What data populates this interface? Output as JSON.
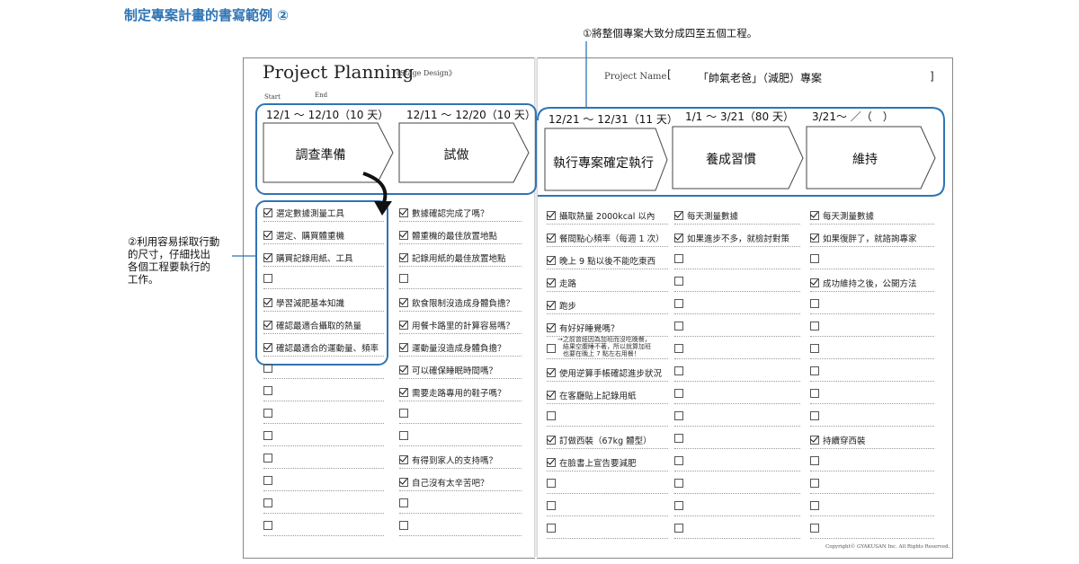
{
  "heading": "制定專案計畫的書寫範例 ②",
  "annotation_top": "①將整個專案大致分成四至五個工程。",
  "annotation_side": [
    "②利用容易採取行動",
    "的尺寸，仔細找出",
    "各個工程要執行的",
    "工作。"
  ],
  "planner": {
    "title": "Project Planning",
    "subtitle": "《Stage Design》",
    "start_label": "Start",
    "end_label": "End",
    "project_name_label": "Project Name",
    "bracket_open": "[",
    "bracket_close": "]",
    "project_name_value": "「帥氣老爸」（減肥）專案",
    "copyright": "Copyright© GYAKUSAN Inc. All Rights Reserved."
  },
  "stages": [
    {
      "dates": "12/1 ～ 12/10（10 天）",
      "name": "調查準備"
    },
    {
      "dates": "12/11 ～ 12/20（10 天）",
      "name": "試做"
    },
    {
      "dates": "12/21 ～ 12/31（11 天）",
      "name": "執行專案確定執行"
    },
    {
      "dates": "1/1 ～ 3/21（80 天）",
      "name": "養成習慣"
    },
    {
      "dates": "3/21～ ／（　）",
      "name": "維持"
    }
  ],
  "tasks": [
    [
      {
        "text": "選定數據測量工具",
        "checked": true
      },
      {
        "text": "選定、購買體重機",
        "checked": true
      },
      {
        "text": "購買記錄用紙、工具",
        "checked": true
      },
      {
        "text": "",
        "checked": false
      },
      {
        "text": "學習減肥基本知識",
        "checked": true
      },
      {
        "text": "確認最適合攝取的熱量",
        "checked": true
      },
      {
        "text": "確認最適合的運動量、頻率",
        "checked": true
      },
      {
        "text": "",
        "checked": false
      },
      {
        "text": "",
        "checked": false
      },
      {
        "text": "",
        "checked": false
      },
      {
        "text": "",
        "checked": false
      },
      {
        "text": "",
        "checked": false
      },
      {
        "text": "",
        "checked": false
      },
      {
        "text": "",
        "checked": false
      },
      {
        "text": "",
        "checked": false
      }
    ],
    [
      {
        "text": "數據確認完成了嗎？",
        "checked": true
      },
      {
        "text": "體重機的最佳放置地點",
        "checked": true
      },
      {
        "text": "記錄用紙的最佳放置地點",
        "checked": true
      },
      {
        "text": "",
        "checked": false
      },
      {
        "text": "飲食限制沒造成身體負擔？",
        "checked": true
      },
      {
        "text": "用餐卡路里的計算容易嗎？",
        "checked": true
      },
      {
        "text": "運動量沒造成身體負擔？",
        "checked": true
      },
      {
        "text": "可以確保睡眠時間嗎？",
        "checked": true
      },
      {
        "text": "需要走路專用的鞋子嗎？",
        "checked": true
      },
      {
        "text": "",
        "checked": false
      },
      {
        "text": "",
        "checked": false
      },
      {
        "text": "有得到家人的支持嗎？",
        "checked": true
      },
      {
        "text": "自己沒有太辛苦吧？",
        "checked": true
      },
      {
        "text": "",
        "checked": false
      },
      {
        "text": "",
        "checked": false
      }
    ],
    [
      {
        "text": "攝取熱量 2000kcal 以內",
        "checked": true
      },
      {
        "text": "餐間點心頻率（每週 1 次）",
        "checked": true
      },
      {
        "text": "晚上 9 點以後不能吃東西",
        "checked": true
      },
      {
        "text": "走路",
        "checked": true
      },
      {
        "text": "跑步",
        "checked": true
      },
      {
        "text": "有好好睡覺嗎？",
        "checked": true
      },
      {
        "text": "",
        "checked": false
      },
      {
        "text": "使用逆算手帳確認進步狀況",
        "checked": true
      },
      {
        "text": "在客廳貼上記錄用紙",
        "checked": true
      },
      {
        "text": "",
        "checked": false
      },
      {
        "text": "訂做西裝（67kg 體型）",
        "checked": true
      },
      {
        "text": "在臉書上宣告要減肥",
        "checked": true
      },
      {
        "text": "",
        "checked": false
      },
      {
        "text": "",
        "checked": false
      },
      {
        "text": "",
        "checked": false
      }
    ],
    [
      {
        "text": "每天測量數據",
        "checked": true
      },
      {
        "text": "如果進步不多，就檢討對策",
        "checked": true
      },
      {
        "text": "",
        "checked": false
      },
      {
        "text": "",
        "checked": false
      },
      {
        "text": "",
        "checked": false
      },
      {
        "text": "",
        "checked": false
      },
      {
        "text": "",
        "checked": false
      },
      {
        "text": "",
        "checked": false
      },
      {
        "text": "",
        "checked": false
      },
      {
        "text": "",
        "checked": false
      },
      {
        "text": "",
        "checked": false
      },
      {
        "text": "",
        "checked": false
      },
      {
        "text": "",
        "checked": false
      },
      {
        "text": "",
        "checked": false
      },
      {
        "text": "",
        "checked": false
      }
    ],
    [
      {
        "text": "每天測量數據",
        "checked": true
      },
      {
        "text": "如果復胖了，就諮詢專家",
        "checked": true
      },
      {
        "text": "",
        "checked": false
      },
      {
        "text": "成功維持之後，公開方法",
        "checked": true
      },
      {
        "text": "",
        "checked": false
      },
      {
        "text": "",
        "checked": false
      },
      {
        "text": "",
        "checked": false
      },
      {
        "text": "",
        "checked": false
      },
      {
        "text": "",
        "checked": false
      },
      {
        "text": "",
        "checked": false
      },
      {
        "text": "持續穿西裝",
        "checked": true
      },
      {
        "text": "",
        "checked": false
      },
      {
        "text": "",
        "checked": false
      },
      {
        "text": "",
        "checked": false
      },
      {
        "text": "",
        "checked": false
      }
    ]
  ],
  "handwritten_note": [
    "→之前曾經因為加班而沒吃晚餐，",
    "結果空腹睡不著，所以就算加班",
    "也要在晚上 7 點左右用餐！"
  ]
}
